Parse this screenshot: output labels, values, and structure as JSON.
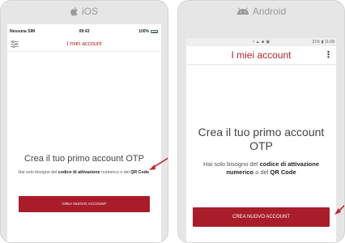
{
  "ios": {
    "platform_label": "iOS",
    "status": {
      "carrier": "Nessuna SIM",
      "time": "09:43",
      "battery": "100%"
    },
    "header_title": "I miei account",
    "headline": "Crea il tuo primo account OTP",
    "sub_prefix": "Hai solo bisogno del ",
    "sub_bold1": "codice di attivazione",
    "sub_mid": " numerico o del ",
    "sub_bold2": "QR Code",
    "sub_suffix": ".",
    "button_label": "CREA NUOVO ACCOUNT"
  },
  "android": {
    "platform_label": "Android",
    "status": {
      "indicators": "♆▲ ■ ▣",
      "right": "21% ▮ 11:08"
    },
    "header_title": "I miei account",
    "menu_icon": "⋮",
    "headline": "Crea il tuo primo account OTP",
    "sub_prefix": "Hai solo bisogno del ",
    "sub_bold1": "codice di attivazione numerico",
    "sub_mid": " o del ",
    "sub_bold2": "QR Code",
    "button_label": "CREA NUOVO ACCOUNT"
  },
  "colors": {
    "accent": "#a91d2b",
    "title": "#b0252f",
    "frame": "#e6e6e6",
    "arrow": "#c0262f"
  }
}
